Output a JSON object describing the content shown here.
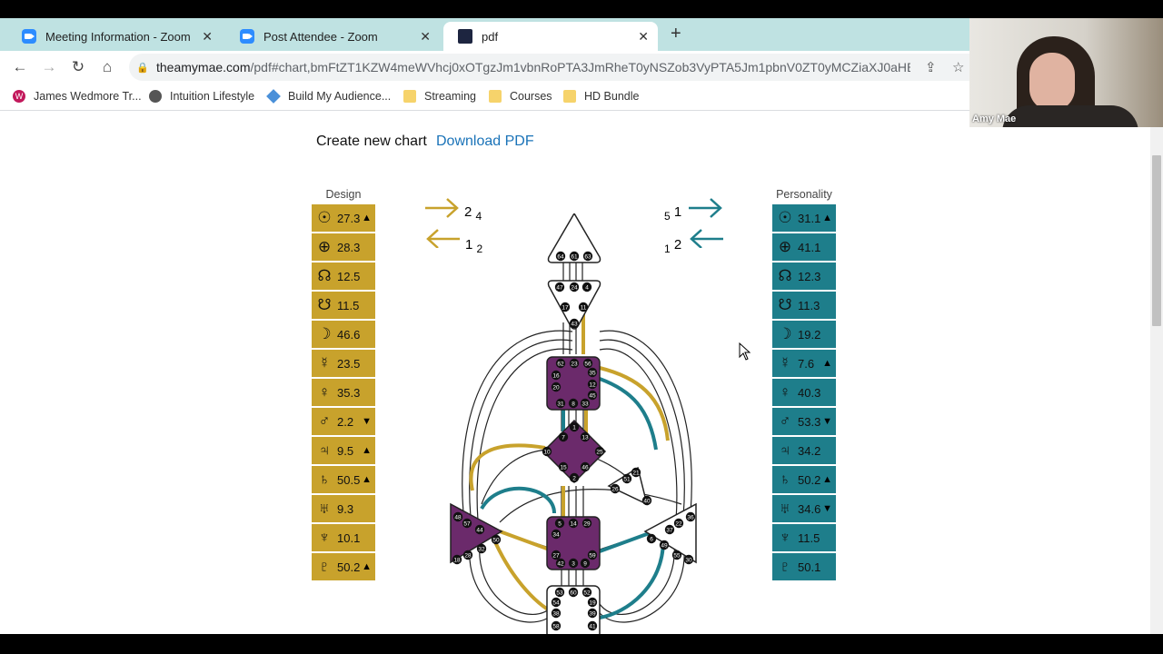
{
  "browser": {
    "tabs": [
      {
        "label": "Meeting Information - Zoom",
        "icon": "zoom-icon"
      },
      {
        "label": "Post Attendee - Zoom",
        "icon": "zoom-icon"
      },
      {
        "label": "pdf",
        "icon": "pdf-favicon",
        "active": true
      }
    ],
    "url_domain": "theamymae.com",
    "url_path": "/pdf#chart,bmFtZT1KZW4meWVhcj0xOTgzJm1vbnRoPTA3JmRheT0yNSZob3VyPTA5Jm1pbnV0ZT0yMCZiaXJ0aHBsY...",
    "bookmarks": [
      {
        "label": "James Wedmore Tr...",
        "icon": "w-logo-icon"
      },
      {
        "label": "Intuition Lifestyle",
        "icon": "globe-icon"
      },
      {
        "label": "Build My Audience...",
        "icon": "diamond-icon"
      },
      {
        "label": "Streaming",
        "icon": "folder-icon"
      },
      {
        "label": "Courses",
        "icon": "folder-icon"
      },
      {
        "label": "HD Bundle",
        "icon": "folder-icon"
      }
    ]
  },
  "page": {
    "create_label": "Create new chart",
    "download_label": "Download PDF",
    "design_heading": "Design",
    "personality_heading": "Personality",
    "design_arrows": {
      "top_a": "2",
      "top_b": "4",
      "bottom_a": "1",
      "bottom_b": "2"
    },
    "personality_arrows": {
      "top_a": "5",
      "top_b": "1",
      "bottom_a": "1",
      "bottom_b": "2"
    },
    "design": [
      {
        "symbol": "☉",
        "value": "27.3",
        "arrow": "▲"
      },
      {
        "symbol": "⊕",
        "value": "28.3",
        "arrow": ""
      },
      {
        "symbol": "☊",
        "value": "12.5",
        "arrow": ""
      },
      {
        "symbol": "☋",
        "value": "11.5",
        "arrow": ""
      },
      {
        "symbol": "☽",
        "value": "46.6",
        "arrow": ""
      },
      {
        "symbol": "☿",
        "value": "23.5",
        "arrow": ""
      },
      {
        "symbol": "♀",
        "value": "35.3",
        "arrow": ""
      },
      {
        "symbol": "♂",
        "value": "2.2",
        "arrow": "▼"
      },
      {
        "symbol": "♃",
        "value": "9.5",
        "arrow": "▲"
      },
      {
        "symbol": "♄",
        "value": "50.5",
        "arrow": "▲"
      },
      {
        "symbol": "♅",
        "value": "9.3",
        "arrow": ""
      },
      {
        "symbol": "♆",
        "value": "10.1",
        "arrow": ""
      },
      {
        "symbol": "♇",
        "value": "50.2",
        "arrow": "▲"
      }
    ],
    "personality": [
      {
        "symbol": "☉",
        "value": "31.1",
        "arrow": "▲"
      },
      {
        "symbol": "⊕",
        "value": "41.1",
        "arrow": ""
      },
      {
        "symbol": "☊",
        "value": "12.3",
        "arrow": ""
      },
      {
        "symbol": "☋",
        "value": "11.3",
        "arrow": ""
      },
      {
        "symbol": "☽",
        "value": "19.2",
        "arrow": ""
      },
      {
        "symbol": "☿",
        "value": "7.6",
        "arrow": "▲"
      },
      {
        "symbol": "♀",
        "value": "40.3",
        "arrow": ""
      },
      {
        "symbol": "♂",
        "value": "53.3",
        "arrow": "▼"
      },
      {
        "symbol": "♃",
        "value": "34.2",
        "arrow": ""
      },
      {
        "symbol": "♄",
        "value": "50.2",
        "arrow": "▲"
      },
      {
        "symbol": "♅",
        "value": "34.6",
        "arrow": "▼"
      },
      {
        "symbol": "♆",
        "value": "11.5",
        "arrow": ""
      },
      {
        "symbol": "♇",
        "value": "50.1",
        "arrow": ""
      }
    ],
    "bodygraph": {
      "head_gates": [
        "64",
        "61",
        "63"
      ],
      "ajna_gates": [
        "47",
        "24",
        "4",
        "17",
        "11",
        "43"
      ],
      "throat_gates": [
        "62",
        "23",
        "56",
        "16",
        "35",
        "20",
        "12",
        "45",
        "31",
        "8",
        "33"
      ],
      "g_gates": [
        "1",
        "7",
        "13",
        "10",
        "25",
        "15",
        "46",
        "2"
      ],
      "ego_gates": [
        "21",
        "51",
        "26",
        "40"
      ],
      "sacral_gates": [
        "5",
        "14",
        "29",
        "34",
        "27",
        "59",
        "42",
        "3",
        "9"
      ],
      "spleen_gates": [
        "48",
        "57",
        "44",
        "50",
        "32",
        "28",
        "18"
      ],
      "solar_gates": [
        "36",
        "22",
        "37",
        "6",
        "49",
        "55",
        "30"
      ],
      "root_gates": [
        "53",
        "60",
        "52",
        "54",
        "19",
        "38",
        "39",
        "58",
        "41"
      ]
    }
  },
  "webcam": {
    "name": "Amy Mae"
  },
  "colors": {
    "design": "#c8a22c",
    "personality": "#1e7e8b",
    "center_defined": "#6b2a6b",
    "tabstrip": "#bfe2e2"
  }
}
